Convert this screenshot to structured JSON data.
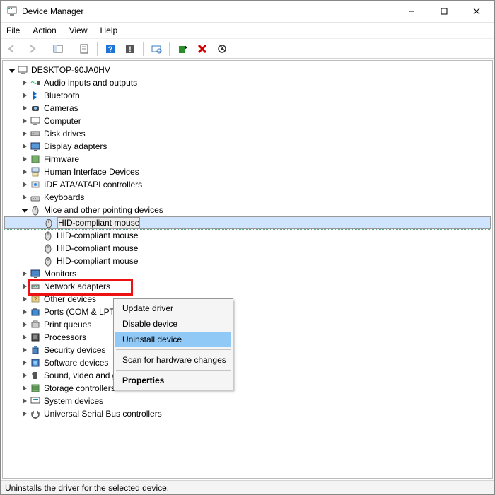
{
  "title": "Device Manager",
  "menu": {
    "file": "File",
    "action": "Action",
    "view": "View",
    "help": "Help"
  },
  "tree": {
    "root": "DESKTOP-90JA0HV",
    "cats": [
      {
        "label": "Audio inputs and outputs"
      },
      {
        "label": "Bluetooth"
      },
      {
        "label": "Cameras"
      },
      {
        "label": "Computer"
      },
      {
        "label": "Disk drives"
      },
      {
        "label": "Display adapters"
      },
      {
        "label": "Firmware"
      },
      {
        "label": "Human Interface Devices"
      },
      {
        "label": "IDE ATA/ATAPI controllers"
      },
      {
        "label": "Keyboards"
      },
      {
        "label": "Mice and other pointing devices"
      },
      {
        "label": "Monitors"
      },
      {
        "label": "Network adapters"
      },
      {
        "label": "Other devices"
      },
      {
        "label": "Ports (COM & LPT)"
      },
      {
        "label": "Print queues"
      },
      {
        "label": "Processors"
      },
      {
        "label": "Security devices"
      },
      {
        "label": "Software devices"
      },
      {
        "label": "Sound, video and game controllers"
      },
      {
        "label": "Storage controllers"
      },
      {
        "label": "System devices"
      },
      {
        "label": "Universal Serial Bus controllers"
      }
    ],
    "mouse_child": "HID-compliant mouse"
  },
  "context_menu": {
    "update": "Update driver",
    "disable": "Disable device",
    "uninstall": "Uninstall device",
    "scan": "Scan for hardware changes",
    "props": "Properties"
  },
  "status": "Uninstalls the driver for the selected device."
}
